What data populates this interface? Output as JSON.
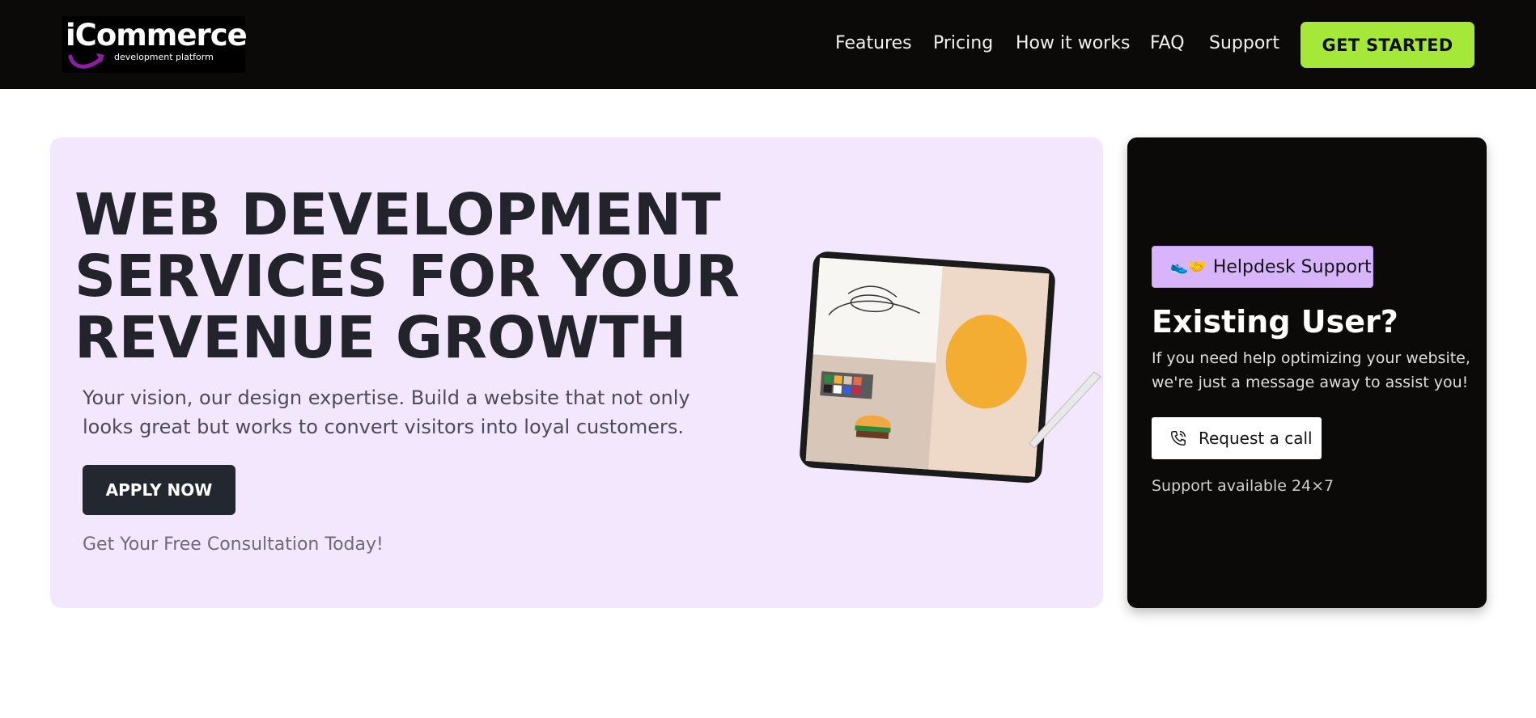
{
  "header": {
    "logo": {
      "name": "iCommerce",
      "tagline": "development platform"
    },
    "nav": [
      {
        "label": "Features"
      },
      {
        "label": "Pricing"
      },
      {
        "label": "How it works"
      },
      {
        "label": "FAQ"
      },
      {
        "label": "Support"
      }
    ],
    "cta_label": "GET STARTED"
  },
  "hero": {
    "headline_lines": [
      "WEB DEVELOPMENT",
      "SERVICES FOR YOUR",
      "REVENUE GROWTH"
    ],
    "subtitle": "Your vision, our design expertise. Build a website that not only looks great but works to convert visitors into loyal customers.",
    "apply_label": "APPLY NOW",
    "consultation": "Get Your Free Consultation Today!",
    "illustration": "tablet-illustration"
  },
  "support": {
    "badge_emoji": "👟🤝",
    "badge_label": "Helpdesk Support",
    "title": "Existing User?",
    "text": "If you need help optimizing your website, we're just a message away to assist you!",
    "call_label": "Request a call",
    "call_icon": "phone-icon",
    "availability": "Support available 24×7"
  },
  "colors": {
    "header_bg": "#0b0a09",
    "accent_green": "#a6e83a",
    "hero_bg": "#f3e7fe",
    "badge_bg": "#d8b5fb",
    "dark_button": "#23272f"
  }
}
